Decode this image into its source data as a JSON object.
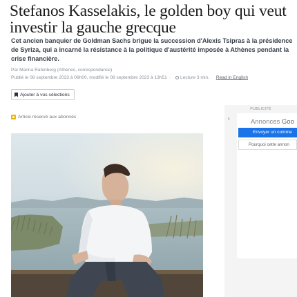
{
  "article": {
    "headline": "Stefanos Kasselakis, le golden boy qui veut investir la gauche grecque",
    "chapo": "Cet ancien banquier de Goldman Sachs brigue la succession d'Alexis Tsipras à la présidence de Syriza, qui a incarné la résistance à la politique d'austérité imposée à Athènes pendant la crise financière.",
    "author": "Par Marina Rafenberg (Athènes, correspondance)",
    "published": "Publié le 08 septembre 2023 à 06h00, modifié le 08 septembre 2023 à 13h51",
    "separator": "·",
    "reading_time": "Lecture 3 min.",
    "read_english": "Read in English",
    "add_selection": "Ajouter à vos sélections",
    "subscribers_label": "Article réservé aux abonnés"
  },
  "icons": {
    "bookmark": "bookmark-icon",
    "key": "key-icon",
    "clock": "clock-icon",
    "back": "back-arrow-icon"
  },
  "ad": {
    "label": "PUBLICITÉ",
    "back_glyph": "‹",
    "title_prefix": "Annonces ",
    "title_brand": "Goo",
    "primary_button": "Envoyer un comme",
    "secondary_button": "Pourquoi cette annon"
  },
  "colors": {
    "accent_blue": "#1a73e8",
    "key_yellow": "#f0b400"
  }
}
